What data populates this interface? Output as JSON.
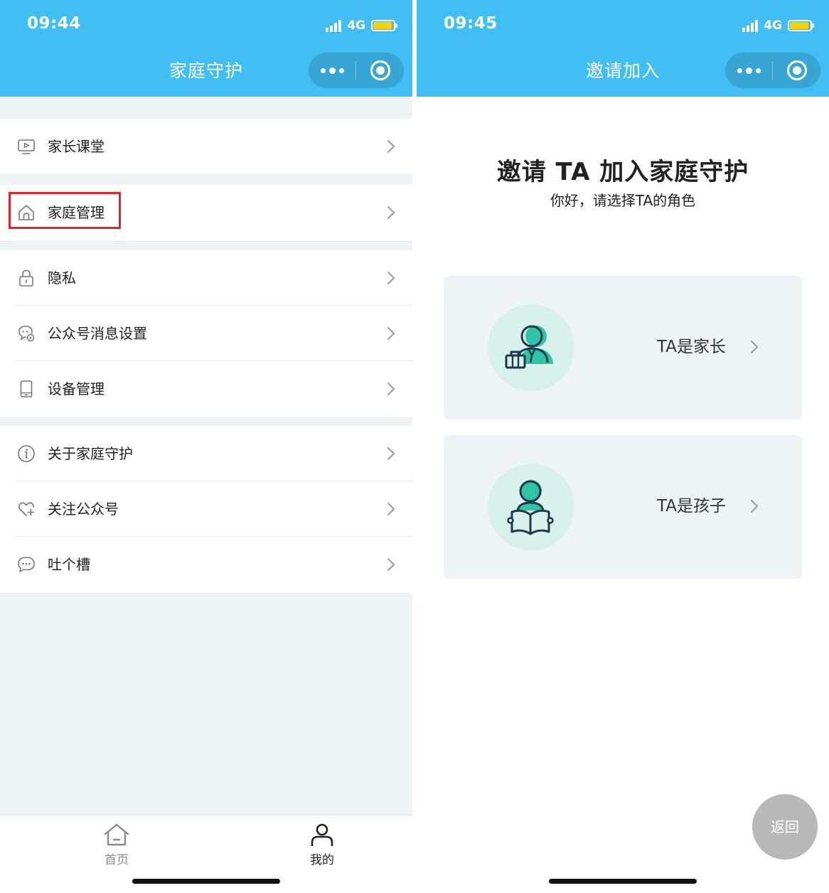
{
  "left": {
    "status": {
      "time": "09:44",
      "network": "4G"
    },
    "nav_title": "家庭守护",
    "menu_groups": [
      [
        {
          "label": "家长课堂",
          "icon": "video-lesson-icon"
        }
      ],
      [
        {
          "label": "家庭管理",
          "icon": "home-icon",
          "highlighted": true
        }
      ],
      [
        {
          "label": "隐私",
          "icon": "lock-icon"
        },
        {
          "label": "公众号消息设置",
          "icon": "message-settings-icon"
        },
        {
          "label": "设备管理",
          "icon": "phone-device-icon"
        }
      ],
      [
        {
          "label": "关于家庭守护",
          "icon": "info-icon"
        },
        {
          "label": "关注公众号",
          "icon": "heart-follow-icon"
        },
        {
          "label": "吐个槽",
          "icon": "chat-bubble-icon"
        }
      ]
    ],
    "tabbar": [
      {
        "label": "首页",
        "icon": "home-tab-icon",
        "active": false
      },
      {
        "label": "我的",
        "icon": "person-tab-icon",
        "active": true
      }
    ]
  },
  "right": {
    "status": {
      "time": "09:45",
      "network": "4G"
    },
    "nav_title": "邀请加入",
    "heading": "邀请 TA 加入家庭守护",
    "subheading": "你好，请选择TA的角色",
    "roles": [
      {
        "label": "TA是家长",
        "icon": "parent-briefcase-icon"
      },
      {
        "label": "TA是孩子",
        "icon": "child-reading-icon"
      }
    ],
    "back_button": "返回"
  },
  "colors": {
    "header": "#41bff5",
    "highlight_border": "#e0242c",
    "avatar_bg": "#d9f1ec",
    "accent_teal": "#2ec4a5"
  }
}
